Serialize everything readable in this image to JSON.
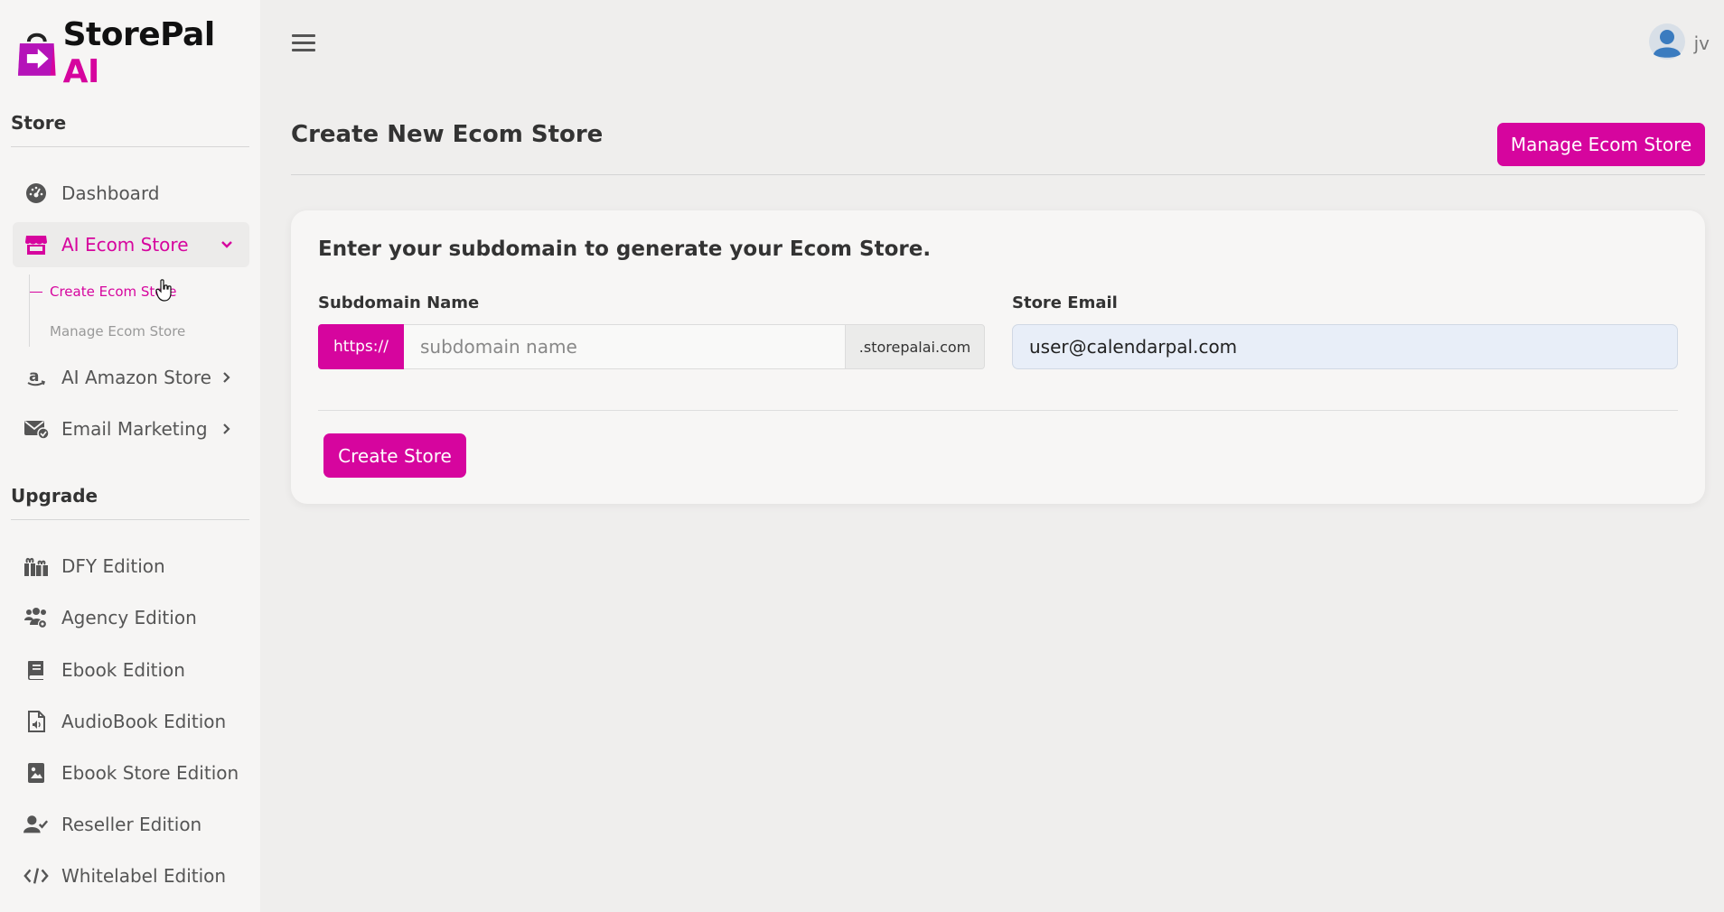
{
  "brand": {
    "name_main": "StorePal",
    "name_accent": "AI"
  },
  "sidebar": {
    "store_section": "Store",
    "store_items": [
      {
        "label": "Dashboard",
        "icon": "gauge-icon"
      },
      {
        "label": "AI Ecom Store",
        "icon": "store-icon",
        "active": true
      },
      {
        "label": "AI Amazon Store",
        "icon": "amazon-icon"
      },
      {
        "label": "Email Marketing",
        "icon": "mail-check-icon"
      }
    ],
    "sub_items": [
      {
        "label": "Create Ecom Store",
        "active": true
      },
      {
        "label": "Manage Ecom Store"
      }
    ],
    "upgrade_section": "Upgrade",
    "upgrade_items": [
      {
        "label": "DFY Edition",
        "icon": "gifts-icon"
      },
      {
        "label": "Agency Edition",
        "icon": "users-gear-icon"
      },
      {
        "label": "Ebook Edition",
        "icon": "book-icon"
      },
      {
        "label": "AudioBook Edition",
        "icon": "file-audio-icon"
      },
      {
        "label": "Ebook Store Edition",
        "icon": "book-image-icon"
      },
      {
        "label": "Reseller Edition",
        "icon": "user-check-icon"
      },
      {
        "label": "Whitelabel Edition",
        "icon": "code-icon"
      }
    ]
  },
  "header": {
    "user_name": "jv"
  },
  "main": {
    "title": "Create New Ecom Store",
    "manage_button": "Manage Ecom Store",
    "card": {
      "title": "Enter your subdomain to generate your Ecom Store.",
      "subdomain_label": "Subdomain Name",
      "subdomain_prefix": "https://",
      "subdomain_placeholder": "subdomain name",
      "subdomain_value": "",
      "subdomain_suffix": ".storepalai.com",
      "email_label": "Store Email",
      "email_value": "user@calendarpal.com",
      "create_button": "Create Store"
    }
  },
  "colors": {
    "accent": "#d6059e",
    "sidebar_bg": "#f6f5f4",
    "page_bg": "#efeeed"
  }
}
